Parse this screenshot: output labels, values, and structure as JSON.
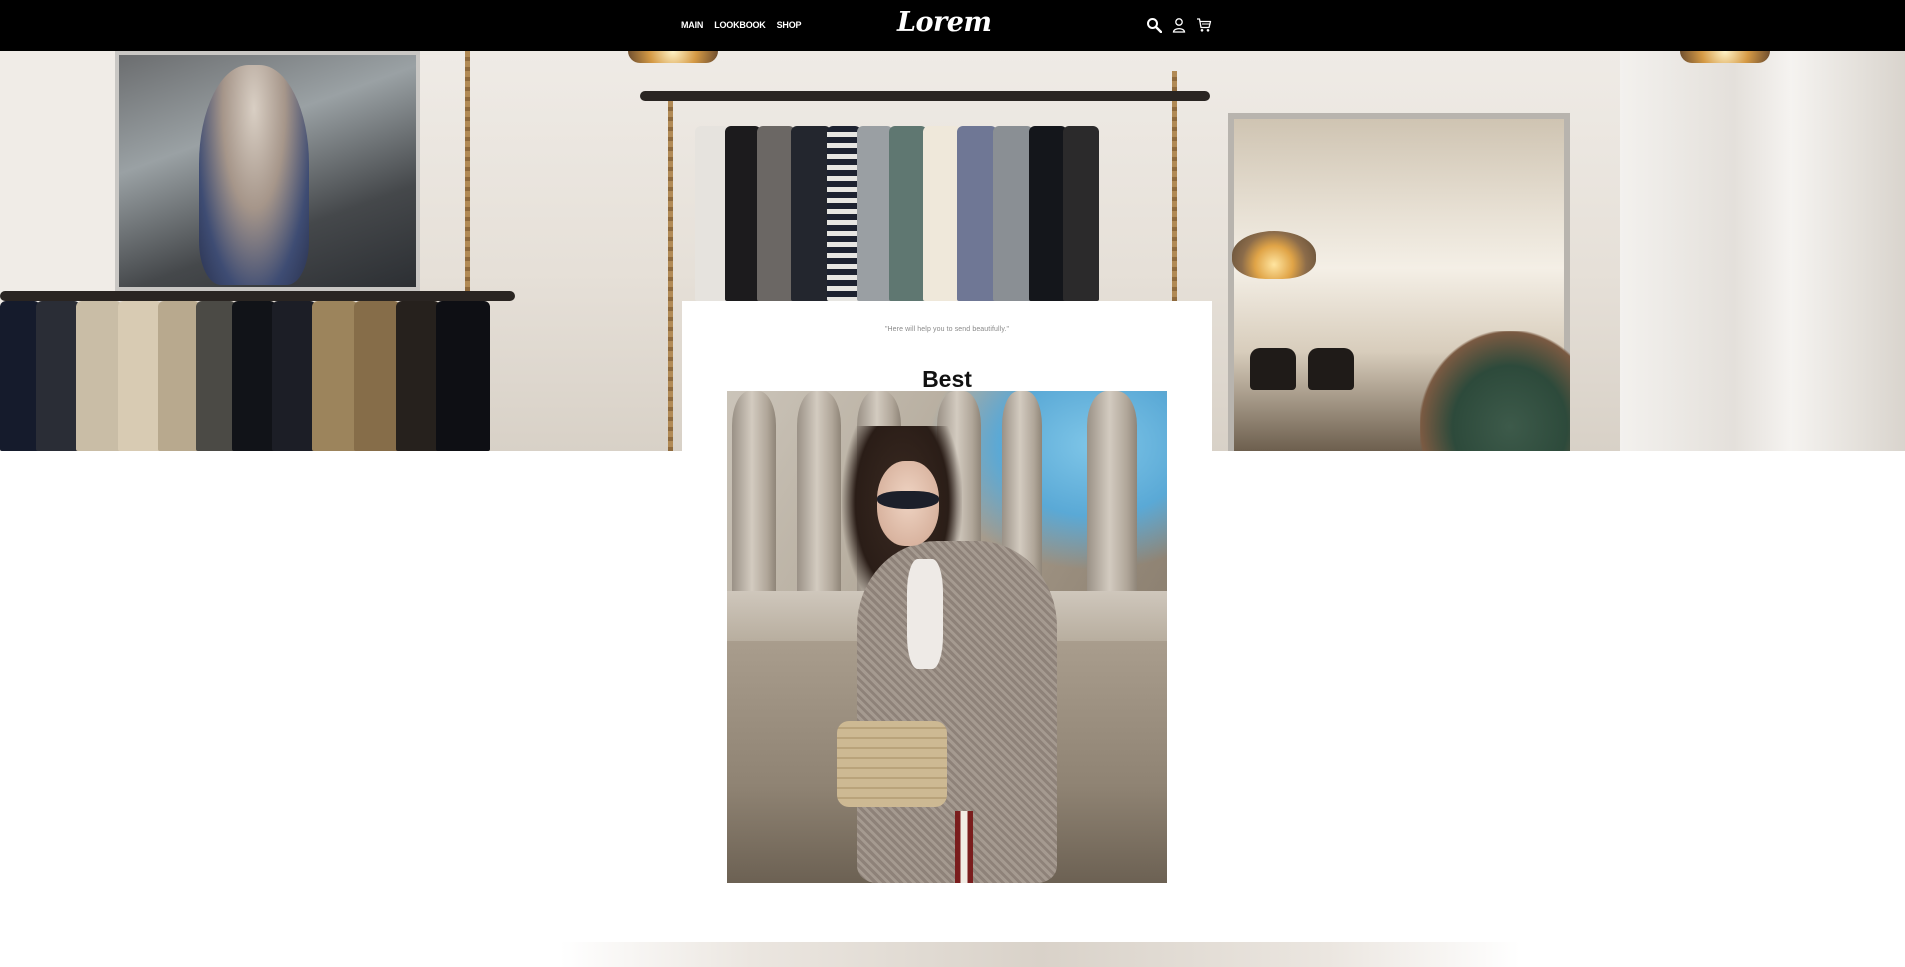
{
  "header": {
    "nav": [
      {
        "label": "MAIN"
      },
      {
        "label": "LOOKBOOK"
      },
      {
        "label": "SHOP"
      }
    ],
    "logo": "Lorem",
    "icons": [
      "search-icon",
      "user-icon",
      "cart-icon"
    ]
  },
  "hero": {
    "image": "clothing-store-interior"
  },
  "card": {
    "quote": "\"Here will help you to send beautifully.\"",
    "title": "Best",
    "image": "woman-in-plaid-jacket-with-sunglasses"
  },
  "colors": {
    "header_bg": "#000000",
    "header_text": "#ffffff",
    "page_bg": "#ffffff",
    "quote_text": "#8a8a8a",
    "title_text": "#111111"
  }
}
